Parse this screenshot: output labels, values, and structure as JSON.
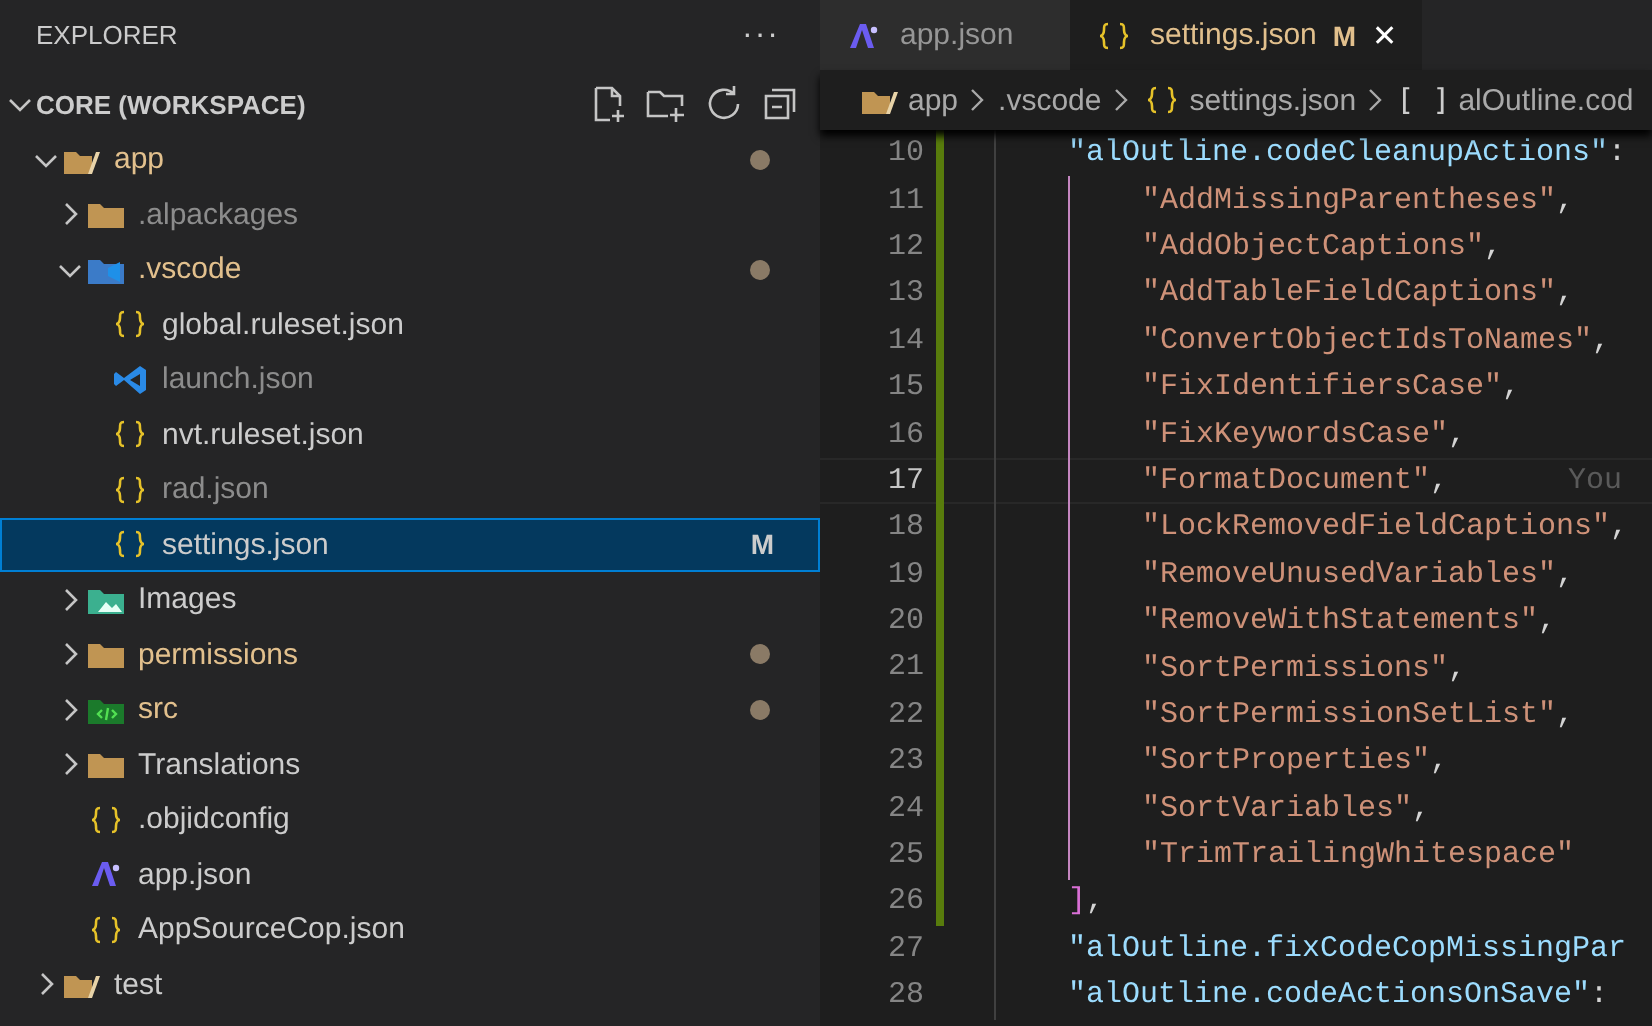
{
  "sidebar": {
    "title": "EXPLORER",
    "more": "···",
    "workspace": {
      "label": "CORE (WORKSPACE)",
      "expanded": true,
      "children": [
        {
          "label": "app",
          "kind": "root",
          "modified": true,
          "ignored": false,
          "dot": true,
          "expanded": true,
          "selected": false,
          "children": [
            {
              "label": ".alpackages",
              "kind": "folder",
              "modified": false,
              "ignored": true,
              "dot": false,
              "expanded": false,
              "selected": false
            },
            {
              "label": ".vscode",
              "kind": "vscodefolder",
              "modified": true,
              "ignored": false,
              "dot": true,
              "expanded": true,
              "selected": false,
              "children": [
                {
                  "label": "global.ruleset.json",
                  "kind": "json",
                  "modified": false,
                  "ignored": false,
                  "dot": false,
                  "selected": false
                },
                {
                  "label": "launch.json",
                  "kind": "launch",
                  "modified": false,
                  "ignored": true,
                  "dot": false,
                  "selected": false
                },
                {
                  "label": "nvt.ruleset.json",
                  "kind": "json",
                  "modified": false,
                  "ignored": false,
                  "dot": false,
                  "selected": false
                },
                {
                  "label": "rad.json",
                  "kind": "json",
                  "modified": false,
                  "ignored": true,
                  "dot": false,
                  "selected": false
                },
                {
                  "label": "settings.json",
                  "kind": "json",
                  "modified": false,
                  "ignored": false,
                  "dot": false,
                  "badge": "M",
                  "selected": true
                }
              ]
            },
            {
              "label": "Images",
              "kind": "images",
              "modified": false,
              "ignored": false,
              "dot": false,
              "expanded": false,
              "selected": false
            },
            {
              "label": "permissions",
              "kind": "folder",
              "modified": true,
              "ignored": false,
              "dot": true,
              "expanded": false,
              "selected": false
            },
            {
              "label": "src",
              "kind": "source",
              "modified": true,
              "ignored": false,
              "dot": true,
              "expanded": false,
              "selected": false
            },
            {
              "label": "Translations",
              "kind": "folder",
              "modified": false,
              "ignored": false,
              "dot": false,
              "expanded": false,
              "selected": false
            },
            {
              "label": ".objidconfig",
              "kind": "json",
              "modified": false,
              "ignored": false,
              "dot": false,
              "selected": false
            },
            {
              "label": "app.json",
              "kind": "al",
              "modified": false,
              "ignored": false,
              "dot": false,
              "selected": false
            },
            {
              "label": "AppSourceCop.json",
              "kind": "json",
              "modified": false,
              "ignored": false,
              "dot": false,
              "selected": false
            }
          ]
        },
        {
          "label": "test",
          "kind": "root",
          "modified": false,
          "ignored": false,
          "dot": false,
          "expanded": false,
          "selected": false
        }
      ]
    }
  },
  "tabs": [
    {
      "label": "app.json",
      "kind": "al",
      "selected": false
    },
    {
      "label": "settings.json",
      "kind": "json",
      "badge": "M",
      "close": "✕",
      "selected": true
    }
  ],
  "breadcrumb": [
    {
      "label": "app",
      "kind": "root"
    },
    {
      "label": ".vscode",
      "kind": "plain"
    },
    {
      "label": "settings.json",
      "kind": "json"
    },
    {
      "label": "alOutline.cod",
      "kind": "array",
      "symbol": "[ ]"
    }
  ],
  "editor": {
    "lines": [
      {
        "number": "10",
        "kind": "key",
        "text": "\"alOutline.codeCleanupActions\"",
        "punct": ":",
        "changed": true,
        "current": false,
        "children": [
          {
            "number": "11",
            "kind": "string",
            "text": "\"AddMissingParentheses\"",
            "punct": ",",
            "changed": true,
            "current": false
          },
          {
            "number": "12",
            "kind": "string",
            "text": "\"AddObjectCaptions\"",
            "punct": ",",
            "changed": true,
            "current": false
          },
          {
            "number": "13",
            "kind": "string",
            "text": "\"AddTableFieldCaptions\"",
            "punct": ",",
            "changed": true,
            "current": false
          },
          {
            "number": "14",
            "kind": "string",
            "text": "\"ConvertObjectIdsToNames\"",
            "punct": ",",
            "changed": true,
            "current": false
          },
          {
            "number": "15",
            "kind": "string",
            "text": "\"FixIdentifiersCase\"",
            "punct": ",",
            "changed": true,
            "current": false
          },
          {
            "number": "16",
            "kind": "string",
            "text": "\"FixKeywordsCase\"",
            "punct": ",",
            "changed": true,
            "current": false
          },
          {
            "number": "17",
            "kind": "string",
            "text": "\"FormatDocument\"",
            "punct": ",",
            "changed": true,
            "current": true,
            "blame": "You"
          },
          {
            "number": "18",
            "kind": "string",
            "text": "\"LockRemovedFieldCaptions\"",
            "punct": ",",
            "changed": true,
            "current": false
          },
          {
            "number": "19",
            "kind": "string",
            "text": "\"RemoveUnusedVariables\"",
            "punct": ",",
            "changed": true,
            "current": false
          },
          {
            "number": "20",
            "kind": "string",
            "text": "\"RemoveWithStatements\"",
            "punct": ",",
            "changed": true,
            "current": false
          },
          {
            "number": "21",
            "kind": "string",
            "text": "\"SortPermissions\"",
            "punct": ",",
            "changed": true,
            "current": false
          },
          {
            "number": "22",
            "kind": "string",
            "text": "\"SortPermissionSetList\"",
            "punct": ",",
            "changed": true,
            "current": false
          },
          {
            "number": "23",
            "kind": "string",
            "text": "\"SortProperties\"",
            "punct": ",",
            "changed": true,
            "current": false
          },
          {
            "number": "24",
            "kind": "string",
            "text": "\"SortVariables\"",
            "punct": ",",
            "changed": true,
            "current": false
          },
          {
            "number": "25",
            "kind": "string",
            "text": "\"TrimTrailingWhitespace\"",
            "changed": true,
            "current": false
          }
        ]
      },
      {
        "number": "26",
        "kind": "bracket",
        "text": "]",
        "punct": ",",
        "changed": true,
        "current": false
      },
      {
        "number": "27",
        "kind": "key",
        "text": "\"alOutline.fixCodeCopMissingPar",
        "changed": false,
        "current": false
      },
      {
        "number": "28",
        "kind": "key",
        "text": "\"alOutline.codeActionsOnSave\"",
        "punct": ":",
        "changed": false,
        "current": false
      }
    ]
  }
}
